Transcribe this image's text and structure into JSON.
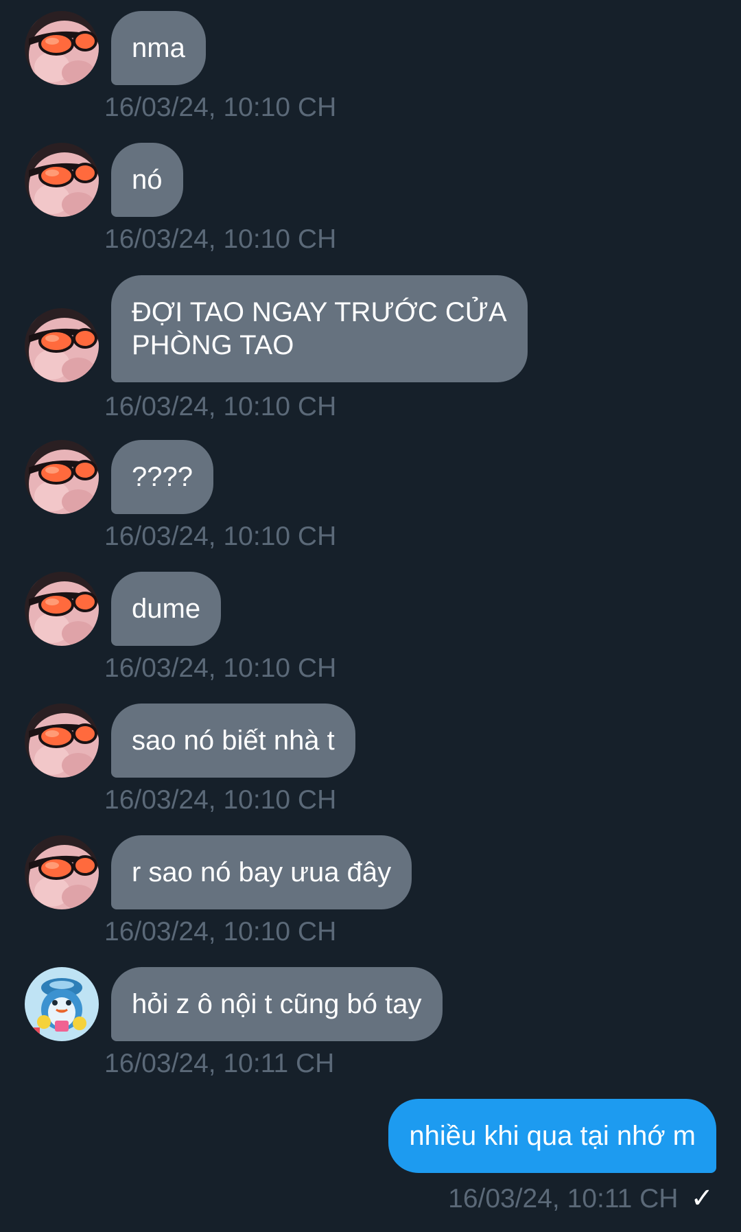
{
  "messages": [
    {
      "text": "nma",
      "time": "16/03/24, 10:10 CH",
      "avatar": "sunglasses-avatar"
    },
    {
      "text": "nó",
      "time": "16/03/24, 10:10 CH",
      "avatar": "sunglasses-avatar"
    },
    {
      "text": "ĐỢI TAO NGAY TRƯỚC CỬA\nPHÒNG TAO",
      "time": "16/03/24, 10:10 CH",
      "avatar": "sunglasses-avatar"
    },
    {
      "text": "????",
      "time": "16/03/24, 10:10 CH",
      "avatar": "sunglasses-avatar"
    },
    {
      "text": "dume",
      "time": "16/03/24, 10:10 CH",
      "avatar": "sunglasses-avatar"
    },
    {
      "text": "sao nó biết nhà t",
      "time": "16/03/24, 10:10 CH",
      "avatar": "sunglasses-avatar"
    },
    {
      "text": "r sao nó bay ưua đây",
      "time": "16/03/24, 10:10 CH",
      "avatar": "sunglasses-avatar"
    },
    {
      "text": "hỏi z ô nội t cũng bó tay",
      "time": "16/03/24, 10:11 CH",
      "avatar": "cartoon-avatar"
    }
  ],
  "outgoing": {
    "text": "nhiều khi qua tại nhớ m",
    "time": "16/03/24, 10:11 CH",
    "status_icon": "checkmark-icon",
    "status_glyph": "✓"
  },
  "colors": {
    "background": "#16202a",
    "incoming_bubble": "#66727f",
    "outgoing_bubble": "#1d9bf0",
    "timestamp": "#5b6978"
  }
}
